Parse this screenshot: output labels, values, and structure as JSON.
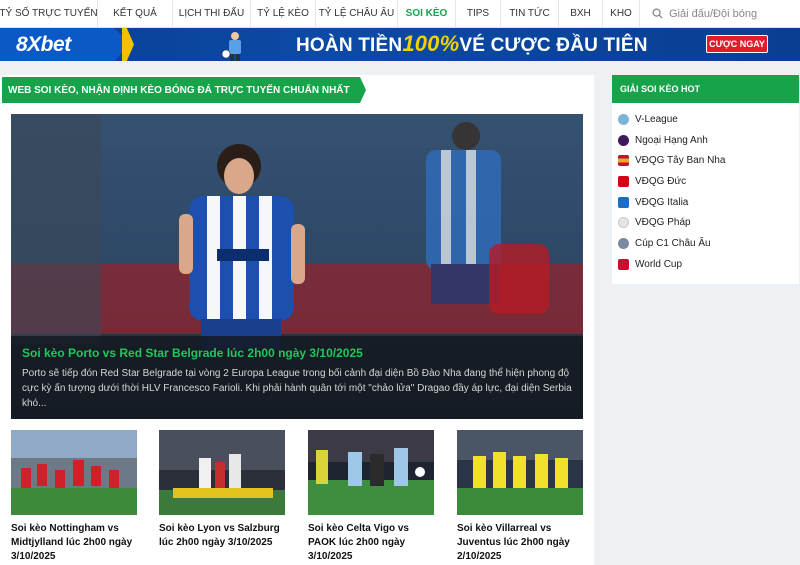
{
  "nav": {
    "items": [
      {
        "label": "Tỷ số trực tuyến",
        "active": false
      },
      {
        "label": "Kết quả",
        "active": false
      },
      {
        "label": "Lịch thi đấu",
        "active": false
      },
      {
        "label": "Tỷ lệ kèo",
        "active": false
      },
      {
        "label": "Tỷ lệ châu Âu",
        "active": false
      },
      {
        "label": "Soi kèo",
        "active": true
      },
      {
        "label": "Tips",
        "active": false
      },
      {
        "label": "Tin tức",
        "active": false
      },
      {
        "label": "BXH",
        "active": false
      },
      {
        "label": "Kho",
        "active": false
      }
    ],
    "search_placeholder": "Giải đấu/Đội bóng"
  },
  "banner": {
    "brand": "8Xbet",
    "headline_pre": "HOÀN TIỀN",
    "headline_pct": "100%",
    "headline_post": "VÉ CƯỢC ĐẦU TIÊN",
    "cta": "CƯỢC NGAY"
  },
  "main": {
    "section_title": "Web soi kèo, nhận định kèo bóng đá trực tuyến chuẩn nhất",
    "hero": {
      "title": "Soi kèo Porto vs Red Star Belgrade lúc 2h00 ngày 3/10/2025",
      "description": "Porto sẽ tiếp đón Red Star Belgrade tại vòng 2 Europa League trong bối cảnh đại diện Bồ Đào Nha đang thể hiện phong độ cực kỳ ấn tượng dưới thời HLV Francesco Farioli. Khi phải hành quân tới một \"chảo lửa\" Dragao đầy áp lực, đại diện Serbia khó..."
    },
    "cards": [
      {
        "title": "Soi kèo Nottingham vs Midtjylland lúc 2h00 ngày 3/10/2025"
      },
      {
        "title": "Soi kèo Lyon vs Salzburg lúc 2h00 ngày 3/10/2025"
      },
      {
        "title": "Soi kèo Celta Vigo vs PAOK lúc 2h00 ngày 3/10/2025"
      },
      {
        "title": "Soi kèo Villarreal vs Juventus lúc 2h00 ngày 2/10/2025"
      }
    ]
  },
  "sidebar": {
    "title": "Giải soi kèo hot",
    "leagues": [
      {
        "label": "V-League",
        "icon": "vleague-icon",
        "color": "#7bb3d9"
      },
      {
        "label": "Ngoại Hạng Anh",
        "icon": "premier-league-icon",
        "color": "#3d195b"
      },
      {
        "label": "VĐQG Tây Ban Nha",
        "icon": "laliga-icon",
        "color": "#e2ad2b"
      },
      {
        "label": "VĐQG Đức",
        "icon": "bundesliga-icon",
        "color": "#d20515"
      },
      {
        "label": "VĐQG Italia",
        "icon": "serie-a-icon",
        "color": "#1a6fc0"
      },
      {
        "label": "VĐQG Pháp",
        "icon": "ligue1-icon",
        "color": "#c9c9c9"
      },
      {
        "label": "Cúp C1 Châu Âu",
        "icon": "champions-league-icon",
        "color": "#7a8aa0"
      },
      {
        "label": "World Cup",
        "icon": "world-cup-icon",
        "color": "#c8102e"
      }
    ]
  }
}
